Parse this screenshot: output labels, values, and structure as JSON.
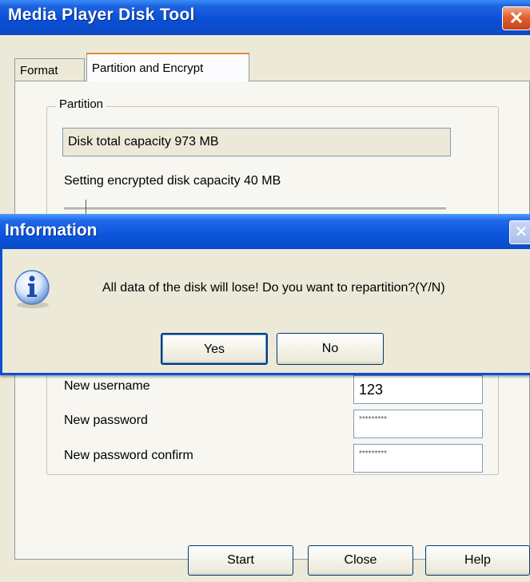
{
  "window": {
    "title": "Media Player Disk Tool",
    "close_glyph": "✕"
  },
  "tabs": [
    {
      "label": "Format"
    },
    {
      "label": "Partition and Encrypt"
    }
  ],
  "partition": {
    "legend": "Partition",
    "capacity_text": "Disk total capacity 973 MB",
    "encrypted_label": "Setting encrypted disk capacity 40 MB"
  },
  "credentials": {
    "username_label": "New username",
    "username_value": "123",
    "password_label": "New password",
    "password_value": "*********",
    "confirm_label": "New password confirm",
    "confirm_value": "*********"
  },
  "buttons": {
    "start": "Start",
    "close": "Close",
    "help": "Help"
  },
  "dialog": {
    "title": "Information",
    "close_glyph": "✕",
    "message": "All data of the disk will lose! Do you want to repartition?(Y/N)",
    "yes": "Yes",
    "no": "No",
    "icon": "info-icon"
  }
}
